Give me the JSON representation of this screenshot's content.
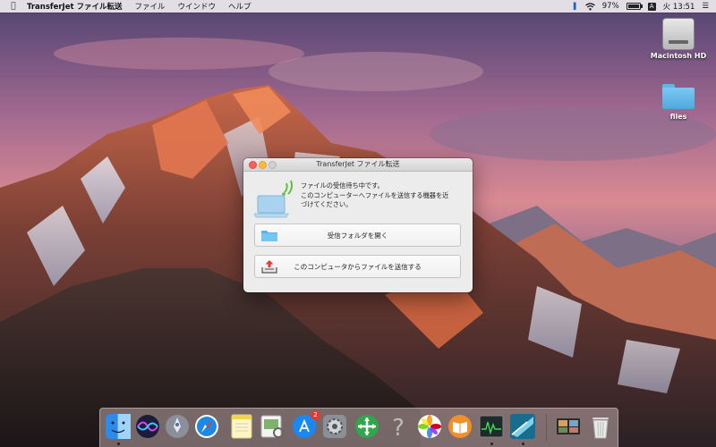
{
  "menubar": {
    "app_name": "TransferJet ファイル転送",
    "menus": [
      "ファイル",
      "ウインドウ",
      "ヘルプ"
    ],
    "battery_percent": "97%",
    "battery_level": 0.97,
    "input_source": "A",
    "clock": "火 13:51"
  },
  "desktop_icons": {
    "hd_label": "Macintosh HD",
    "folder_label": "files"
  },
  "dialog": {
    "title": "TransferJet ファイル転送",
    "status_line1": "ファイルの受信待ち中です。",
    "status_line2": "このコンピューターへファイルを送信する機器を近",
    "status_line3": "づけてください。",
    "open_folder_label": "受信フォルダを開く",
    "send_file_label": "このコンピュータからファイルを送信する"
  },
  "dock": {
    "items": [
      "Finder",
      "Siri",
      "Launchpad",
      "Safari",
      "Notes",
      "Preview",
      "App Store",
      "System Preferences",
      "Compass",
      "Help",
      "Photos",
      "iBooks",
      "Activity Monitor",
      "TransferJet",
      "Photo Booth",
      "Trash"
    ],
    "app_store_badge": "2",
    "accent_colors": {
      "finder": "#2c8ae8",
      "safari": "#1e88e5",
      "appstore": "#1a88f2",
      "green": "#2ea84a",
      "orange": "#f0902a"
    }
  }
}
